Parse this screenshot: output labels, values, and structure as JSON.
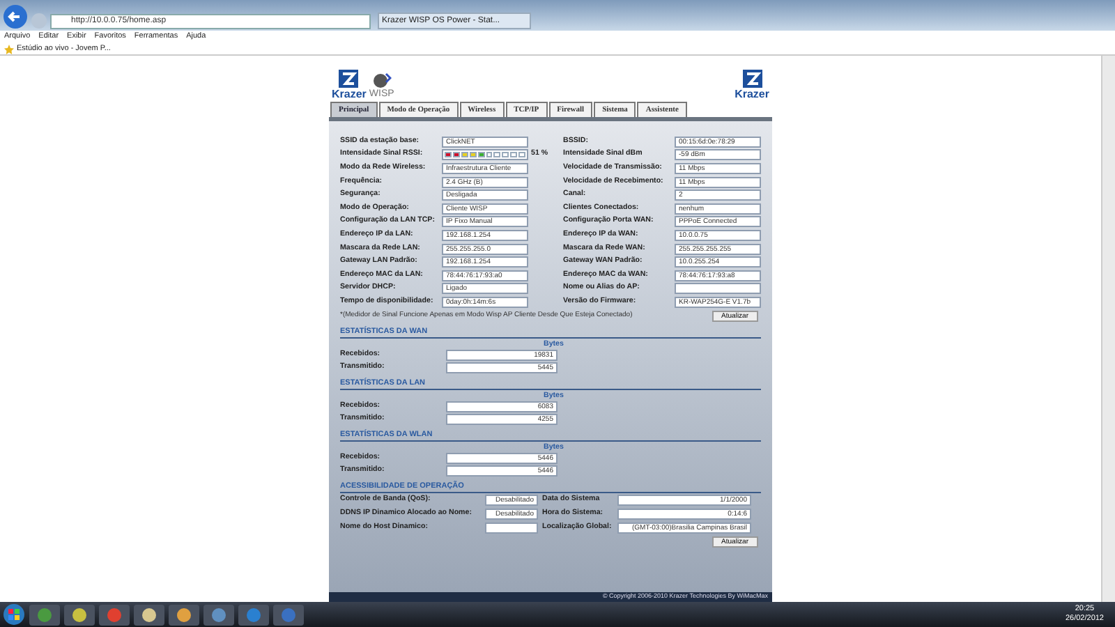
{
  "browser": {
    "url": "http://10.0.0.75/home.asp",
    "tab_title": "Krazer WISP OS Power - Stat...",
    "menu": [
      "Arquivo",
      "Editar",
      "Exibir",
      "Favoritos",
      "Ferramentas",
      "Ajuda"
    ],
    "favorite": "Estúdio ao vivo - Jovem P..."
  },
  "header": {
    "brand": "Krazer",
    "product": "WISP",
    "brand_right": "Krazer"
  },
  "tabs": [
    {
      "label": "Principal",
      "selected": true
    },
    {
      "label": "Modo de Operação",
      "selected": false
    },
    {
      "label": "Wireless",
      "selected": false
    },
    {
      "label": "TCP/IP",
      "selected": false
    },
    {
      "label": "Firewall",
      "selected": false
    },
    {
      "label": "Sistema",
      "selected": false
    },
    {
      "label": "Assistente",
      "selected": false
    }
  ],
  "status": {
    "rows": [
      {
        "left": {
          "label": "SSID da estação base:",
          "value": "ClickNET"
        },
        "right": {
          "label": "BSSID:",
          "value": "00:15:6d:0e:78:29"
        }
      },
      {
        "left": {
          "label": "Intensidade Sinal RSSI:",
          "kind": "meter",
          "level": 0.51,
          "reading": "51 %"
        },
        "right": {
          "label": "Intensidade Sinal dBm",
          "value": "-59 dBm"
        }
      },
      {
        "left": {
          "label": "Modo da Rede Wireless:",
          "value": "Infraestrutura Cliente"
        },
        "right": {
          "label": "Velocidade de Transmissão:",
          "value": "11 Mbps"
        }
      },
      {
        "left": {
          "label": "Frequência:",
          "value": "2.4 GHz (B)"
        },
        "right": {
          "label": "Velocidade de Recebimento:",
          "value": "11 Mbps"
        }
      },
      {
        "left": {
          "label": "Segurança:",
          "value": "Desligada"
        },
        "right": {
          "label": "Canal:",
          "value": "2"
        }
      },
      {
        "left": {
          "label": "Modo de Operação:",
          "value": "Cliente WISP"
        },
        "right": {
          "label": "Clientes Conectados:",
          "value": "nenhum"
        }
      },
      {
        "left": {
          "label": "Configuração da LAN TCP:",
          "value": "IP Fixo Manual"
        },
        "right": {
          "label": "Configuração Porta WAN:",
          "value": "PPPoE Connected"
        }
      },
      {
        "left": {
          "label": "Endereço IP da LAN:",
          "value": "192.168.1.254"
        },
        "right": {
          "label": "Endereço IP da WAN:",
          "value": "10.0.0.75"
        }
      },
      {
        "left": {
          "label": "Mascara da Rede LAN:",
          "value": "255.255.255.0"
        },
        "right": {
          "label": "Mascara da Rede WAN:",
          "value": "255.255.255.255"
        }
      },
      {
        "left": {
          "label": "Gateway LAN Padrão:",
          "value": "192.168.1.254"
        },
        "right": {
          "label": "Gateway WAN Padrão:",
          "value": "10.0.255.254"
        }
      },
      {
        "left": {
          "label": "Endereço MAC da LAN:",
          "value": "78:44:76:17:93:a0"
        },
        "right": {
          "label": "Endereço MAC da WAN:",
          "value": "78:44:76:17:93:a8"
        }
      },
      {
        "left": {
          "label": "Servidor DHCP:",
          "value": "Ligado"
        },
        "right": {
          "label": "Nome ou Alias do AP:"
        }
      },
      {
        "left": {
          "label": "Tempo de disponibilidade:",
          "value": "0day:0h:14m:6s"
        },
        "right": {
          "label": "Versão do Firmware:",
          "value": "KR-WAP254G-E V1.7b"
        }
      }
    ],
    "note": "*(Medidor de Sinal Funcione Apenas em Modo Wisp AP Cliente Desde Que Esteja Conectado)",
    "button": "Atualizar"
  },
  "stats": [
    {
      "title": "ESTATÍSTICAS DA WAN",
      "unit": "Bytes",
      "rows": [
        {
          "label": "Recebidos:",
          "value": "19831"
        },
        {
          "label": "Transmitido:",
          "value": "5445"
        }
      ]
    },
    {
      "title": "ESTATÍSTICAS DA LAN",
      "unit": "Bytes",
      "rows": [
        {
          "label": "Recebidos:",
          "value": "6083"
        },
        {
          "label": "Transmitido:",
          "value": "4255"
        }
      ]
    },
    {
      "title": "ESTATÍSTICAS DA WLAN",
      "unit": "Bytes",
      "rows": [
        {
          "label": "Recebidos:",
          "value": "5446"
        },
        {
          "label": "Transmitido:",
          "value": "5446"
        }
      ]
    }
  ],
  "access": {
    "title": "ACESSIBILIDADE DE OPERAÇÃO",
    "rows": [
      {
        "left": {
          "label": "Controle de Banda (QoS):",
          "value": "Desabilitado"
        },
        "right": {
          "label": "Data do Sistema",
          "value": "1/1/2000"
        }
      },
      {
        "left": {
          "label": "DDNS IP Dinamico Alocado ao Nome:",
          "value": "Desabilitado"
        },
        "right": {
          "label": "Hora do Sistema:",
          "value": "0:14:6"
        }
      },
      {
        "left": {
          "label": "Nome do Host Dinamico:"
        },
        "right": {
          "label": "Localização Global:",
          "value": "(GMT-03:00)Brasilia Campinas Brasil"
        }
      }
    ],
    "button": "Atualizar"
  },
  "footer": "© Copyright 2006-2010 Krazer Technologies By WiMacMax",
  "taskbar": {
    "time": "20:25",
    "date": "26/02/2012"
  }
}
